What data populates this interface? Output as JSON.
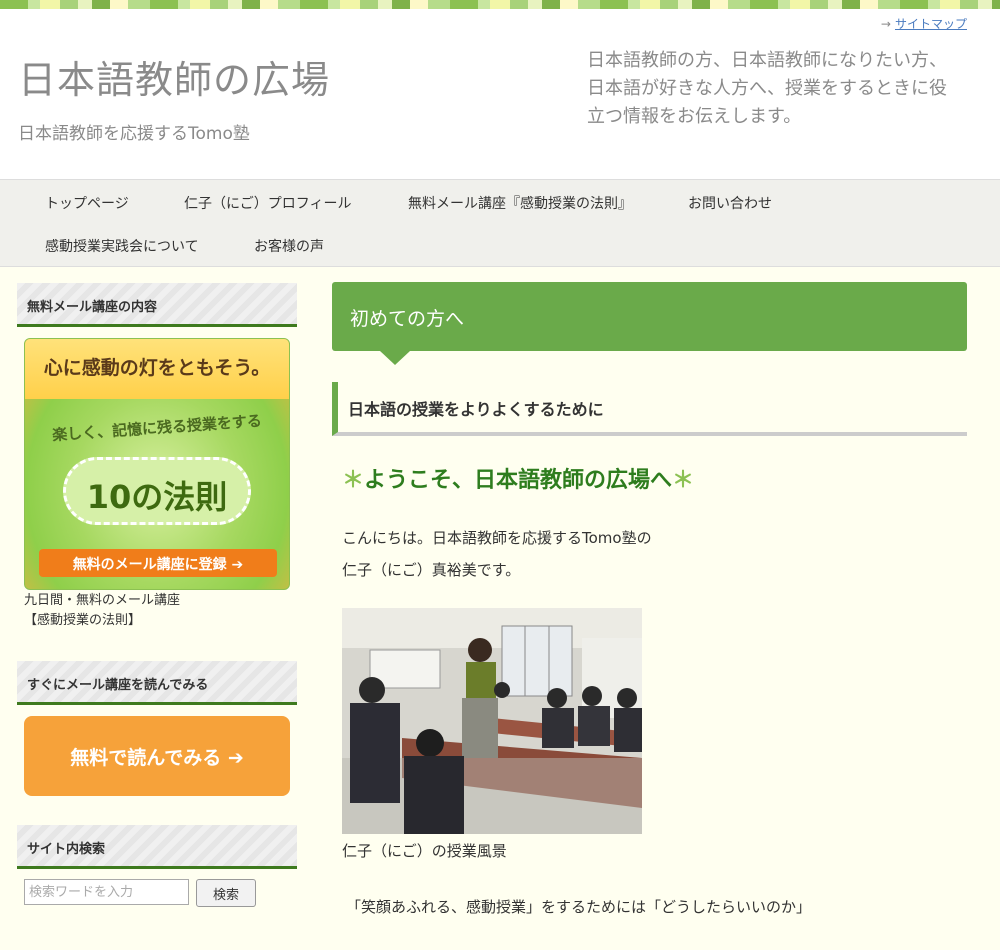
{
  "header": {
    "sitemap_link": "サイトマップ",
    "title": "日本語教師の広場",
    "subtitle": "日本語教師を応援するTomo塾",
    "description": "日本語教師の方、日本語教師になりたい方、日本語が好きな人方へ、授業をするときに役立つ情報をお伝えします。"
  },
  "nav": {
    "items": [
      {
        "label": "トップページ"
      },
      {
        "label": "仁子（にご）プロフィール"
      },
      {
        "label": "無料メール講座『感動授業の法則』"
      },
      {
        "label": "お問い合わせ"
      },
      {
        "label": "感動授業実践会について"
      },
      {
        "label": "お客様の声"
      }
    ]
  },
  "sidebar": {
    "widget1_title": "無料メール講座の内容",
    "banner": {
      "headline": "心に感動の灯をともそう。",
      "sub": "楽しく、記憶に残る授業をする",
      "badge": "10の法則",
      "button": "無料のメール講座に登録 ➔"
    },
    "banner_caption_line1": "九日間・無料のメール講座",
    "banner_caption_line2": "【感動授業の法則】",
    "widget2_title": "すぐにメール講座を読んでみる",
    "read_button": "無料で読んでみる ➔",
    "widget3_title": "サイト内検索",
    "search_placeholder": "検索ワードを入力",
    "search_button": "検索"
  },
  "main": {
    "page_heading": "初めての方へ",
    "section_heading": "日本語の授業をよりよくするために",
    "welcome_star": "＊",
    "welcome_text": "ようこそ、日本語教師の広場へ",
    "intro_line1": "こんにちは。日本語教師を応援するTomo塾の",
    "intro_line2": "仁子（にご）真裕美です。",
    "photo_caption": "仁子（にご）の授業風景",
    "bottom_text": "「笑顔あふれる、感動授業」をするためには「どうしたらいいのか」"
  },
  "colors": {
    "accent_green": "#6aaa4a",
    "dark_green": "#3e7a1e",
    "orange_button": "#f6a23a",
    "background": "#fffff0"
  }
}
